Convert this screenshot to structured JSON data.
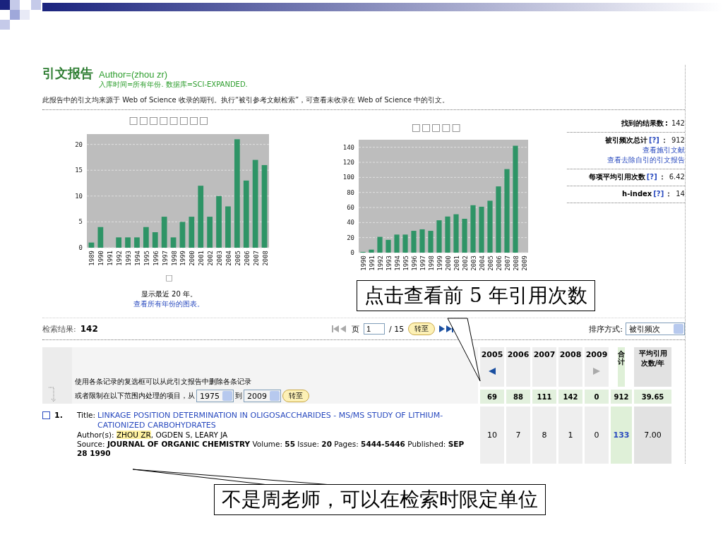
{
  "report": {
    "title": "引文报告",
    "query": "Author=(zhou zr)",
    "scope": "入库时间=所有年份. 数据库=SCI-EXPANDED.",
    "note": "此报告中的引文均来源于 Web of Science 收录的期刊。执行“被引参考文献检索”，可查看未收录在 Web of Science 中的引文。"
  },
  "charts": [
    {
      "chart_data": {
        "type": "bar",
        "title": "□□□□□□□□",
        "categories": [
          "1989",
          "1990",
          "1991",
          "1992",
          "1993",
          "1994",
          "1995",
          "1996",
          "1997",
          "1998",
          "1999",
          "2000",
          "2001",
          "2002",
          "2003",
          "2004",
          "2005",
          "2006",
          "2007",
          "2008"
        ],
        "values": [
          1,
          4,
          0,
          2,
          2,
          2,
          4,
          3,
          6,
          2,
          5,
          6,
          12,
          6,
          10,
          8,
          21,
          13,
          17,
          16
        ],
        "ylim": [
          0,
          22
        ],
        "yticks": [
          0,
          5,
          10,
          15,
          20
        ],
        "grid": true
      },
      "xlabel": "□",
      "caption": "显示最近 20 年。",
      "link": "查看所有年份的图表。"
    },
    {
      "chart_data": {
        "type": "bar",
        "title": "□□□□□",
        "categories": [
          "1990",
          "1991",
          "1992",
          "1993",
          "1994",
          "1995",
          "1996",
          "1997",
          "1998",
          "1999",
          "2000",
          "2001",
          "2002",
          "2003",
          "2004",
          "2005",
          "2006",
          "2007",
          "2008",
          "2009"
        ],
        "values": [
          1,
          4,
          21,
          17,
          24,
          24,
          29,
          31,
          29,
          43,
          48,
          51,
          45,
          63,
          61,
          69,
          88,
          111,
          142,
          0
        ],
        "ylim": [
          0,
          150
        ],
        "yticks": [
          0,
          20,
          40,
          60,
          80,
          100,
          120,
          140
        ],
        "grid": true
      }
    }
  ],
  "summary": [
    {
      "label": "找到的结果数",
      "sep": ":",
      "value": "142"
    },
    {
      "label": "被引频次总计",
      "help": "[?]",
      "sep": "：",
      "value": "912",
      "links": [
        "查看施引文献",
        "查看去除自引的引文报告"
      ]
    },
    {
      "label": "每项平均引用次数",
      "help": "[?]",
      "sep": "：",
      "value": "6.42"
    },
    {
      "label": "h-index ",
      "help": "[?]",
      "sep": "：",
      "value": "14"
    }
  ],
  "results": {
    "label": "检索结果:",
    "count": "142"
  },
  "pager": {
    "back_enabled": false,
    "forward_enabled": true,
    "page_label": "页",
    "page": "1",
    "total": "/ 15",
    "go": "转至"
  },
  "sort": {
    "label": "排序方式:",
    "value": "被引频次"
  },
  "table": {
    "hint": "使用各条记录的复选框可以从此引文报告中删除各条记录",
    "range_label": "或者限制在以下范围内处理的项目，从",
    "from": "1975",
    "to_label": "到",
    "to": "2009",
    "go": "转至",
    "years": [
      "2005",
      "2006",
      "2007",
      "2008",
      "2009"
    ],
    "prev_enabled": true,
    "next_enabled": false,
    "total_label": "合计",
    "avg_label": "平均引用次数/年",
    "totals": {
      "years": [
        "69",
        "88",
        "111",
        "142",
        "0"
      ],
      "total": "912",
      "avg": "39.65"
    },
    "rows": [
      {
        "number": "1.",
        "checked": false,
        "title_label": "Title:",
        "title": "LINKAGE POSITION DETERMINATION IN OLIGOSACCHARIDES - MS/MS STUDY OF LITHIUM-CATIONIZED CARBOHYDRATES",
        "authors_label": "Author(s):",
        "authors": [
          {
            "text": "ZHOU ZR",
            "highlighted": true
          },
          {
            "text": ", OGDEN S, LEARY JA",
            "highlighted": false
          }
        ],
        "source": "Source: **JOURNAL OF ORGANIC CHEMISTRY**  Volume: **55**  Issue: **20**  Pages: **5444-5446**  Published: **SEP 28 1990**",
        "years": [
          "10",
          "7",
          "8",
          "1",
          "0"
        ],
        "total": "133",
        "avg": "7.00"
      }
    ]
  },
  "callouts": [
    {
      "text": "点击查看前 5 年引用次数"
    },
    {
      "text": "不是周老师，可以在检索时限定单位"
    }
  ]
}
